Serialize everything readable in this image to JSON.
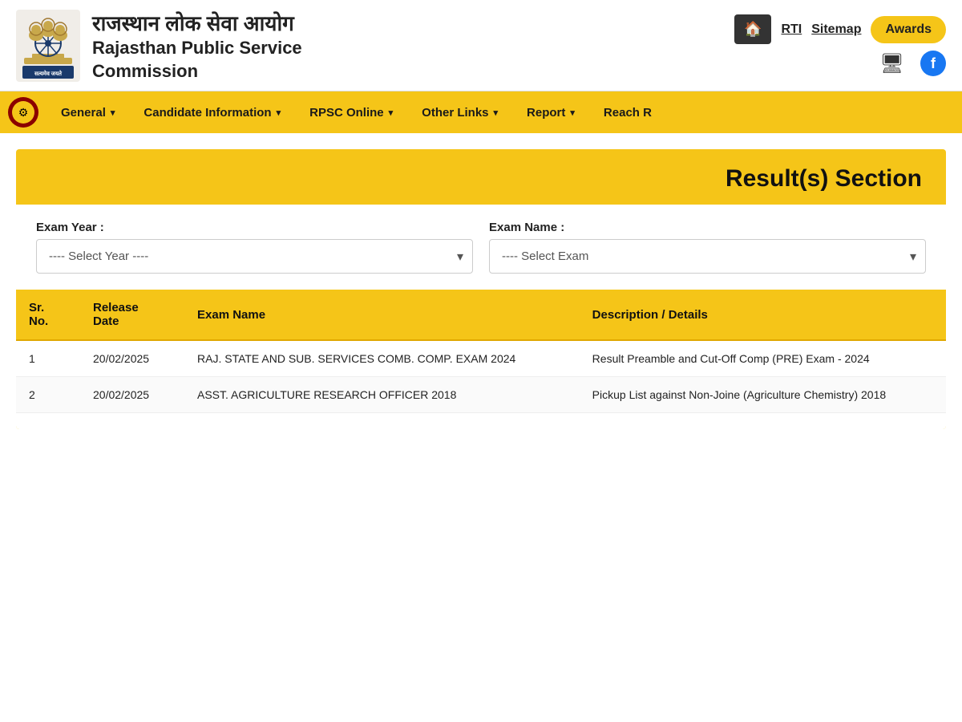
{
  "header": {
    "hindi_name": "राजस्थान लोक सेवा आयोग",
    "english_name_line1": "Rajasthan Public Service",
    "english_name_line2": "Commission",
    "nav_links": {
      "rti": "RTI",
      "sitemap": "Sitemap",
      "awards": "Awards"
    }
  },
  "navbar": {
    "items": [
      {
        "label": "General",
        "has_dropdown": true
      },
      {
        "label": "Candidate Information",
        "has_dropdown": true
      },
      {
        "label": "RPSC Online",
        "has_dropdown": true
      },
      {
        "label": "Other Links",
        "has_dropdown": true
      },
      {
        "label": "Report",
        "has_dropdown": true
      },
      {
        "label": "Reach R",
        "has_dropdown": false
      }
    ]
  },
  "results_section": {
    "title": "Result(s) Section",
    "filters": {
      "year_label": "Exam Year :",
      "year_placeholder": "---- Select Year ----",
      "name_label": "Exam Name :",
      "name_placeholder": "---- Select Exam"
    },
    "table": {
      "headers": [
        "Sr. No.",
        "Release Date",
        "Exam Name",
        "Description / Details"
      ],
      "rows": [
        {
          "sr_no": "1",
          "release_date": "20/02/2025",
          "exam_name": "RAJ. STATE AND SUB. SERVICES COMB. COMP. EXAM 2024",
          "description": "Result Preamble and Cut-Off Comp (PRE) Exam - 2024"
        },
        {
          "sr_no": "2",
          "release_date": "20/02/2025",
          "exam_name": "ASST. AGRICULTURE RESEARCH OFFICER 2018",
          "description": "Pickup List against Non-Joine (Agriculture Chemistry) 2018"
        }
      ]
    }
  },
  "icons": {
    "home": "🏠",
    "monitor": "🖥",
    "facebook": "f",
    "chevron_down": "▾"
  }
}
